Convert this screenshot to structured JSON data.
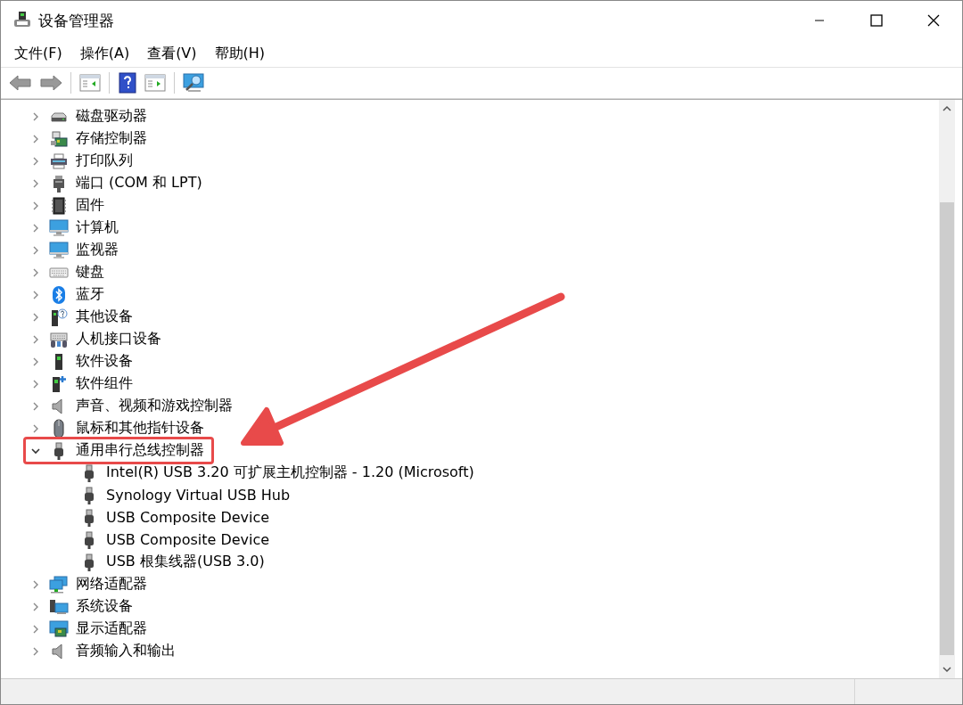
{
  "window": {
    "title": "设备管理器"
  },
  "menu": [
    {
      "label": "文件(F)"
    },
    {
      "label": "操作(A)"
    },
    {
      "label": "查看(V)"
    },
    {
      "label": "帮助(H)"
    }
  ],
  "tree": {
    "items": [
      {
        "label": "磁盘驱动器",
        "expanded": false,
        "highlighted": false
      },
      {
        "label": "存储控制器",
        "expanded": false,
        "highlighted": false
      },
      {
        "label": "打印队列",
        "expanded": false,
        "highlighted": false
      },
      {
        "label": "端口 (COM 和 LPT)",
        "expanded": false,
        "highlighted": false
      },
      {
        "label": "固件",
        "expanded": false,
        "highlighted": false
      },
      {
        "label": "计算机",
        "expanded": false,
        "highlighted": false
      },
      {
        "label": "监视器",
        "expanded": false,
        "highlighted": false
      },
      {
        "label": "键盘",
        "expanded": false,
        "highlighted": false
      },
      {
        "label": "蓝牙",
        "expanded": false,
        "highlighted": false
      },
      {
        "label": "其他设备",
        "expanded": false,
        "highlighted": false
      },
      {
        "label": "人机接口设备",
        "expanded": false,
        "highlighted": false
      },
      {
        "label": "软件设备",
        "expanded": false,
        "highlighted": false
      },
      {
        "label": "软件组件",
        "expanded": false,
        "highlighted": false
      },
      {
        "label": "声音、视频和游戏控制器",
        "expanded": false,
        "highlighted": false
      },
      {
        "label": "鼠标和其他指针设备",
        "expanded": false,
        "highlighted": false
      },
      {
        "label": "通用串行总线控制器",
        "expanded": true,
        "highlighted": true,
        "children": [
          {
            "label": "Intel(R) USB 3.20 可扩展主机控制器 - 1.20 (Microsoft)"
          },
          {
            "label": "Synology Virtual USB Hub"
          },
          {
            "label": "USB Composite Device"
          },
          {
            "label": "USB Composite Device"
          },
          {
            "label": "USB 根集线器(USB 3.0)"
          }
        ]
      },
      {
        "label": "网络适配器",
        "expanded": false,
        "highlighted": false
      },
      {
        "label": "系统设备",
        "expanded": false,
        "highlighted": false
      },
      {
        "label": "显示适配器",
        "expanded": false,
        "highlighted": false
      },
      {
        "label": "音频输入和输出",
        "expanded": false,
        "highlighted": false
      }
    ]
  }
}
